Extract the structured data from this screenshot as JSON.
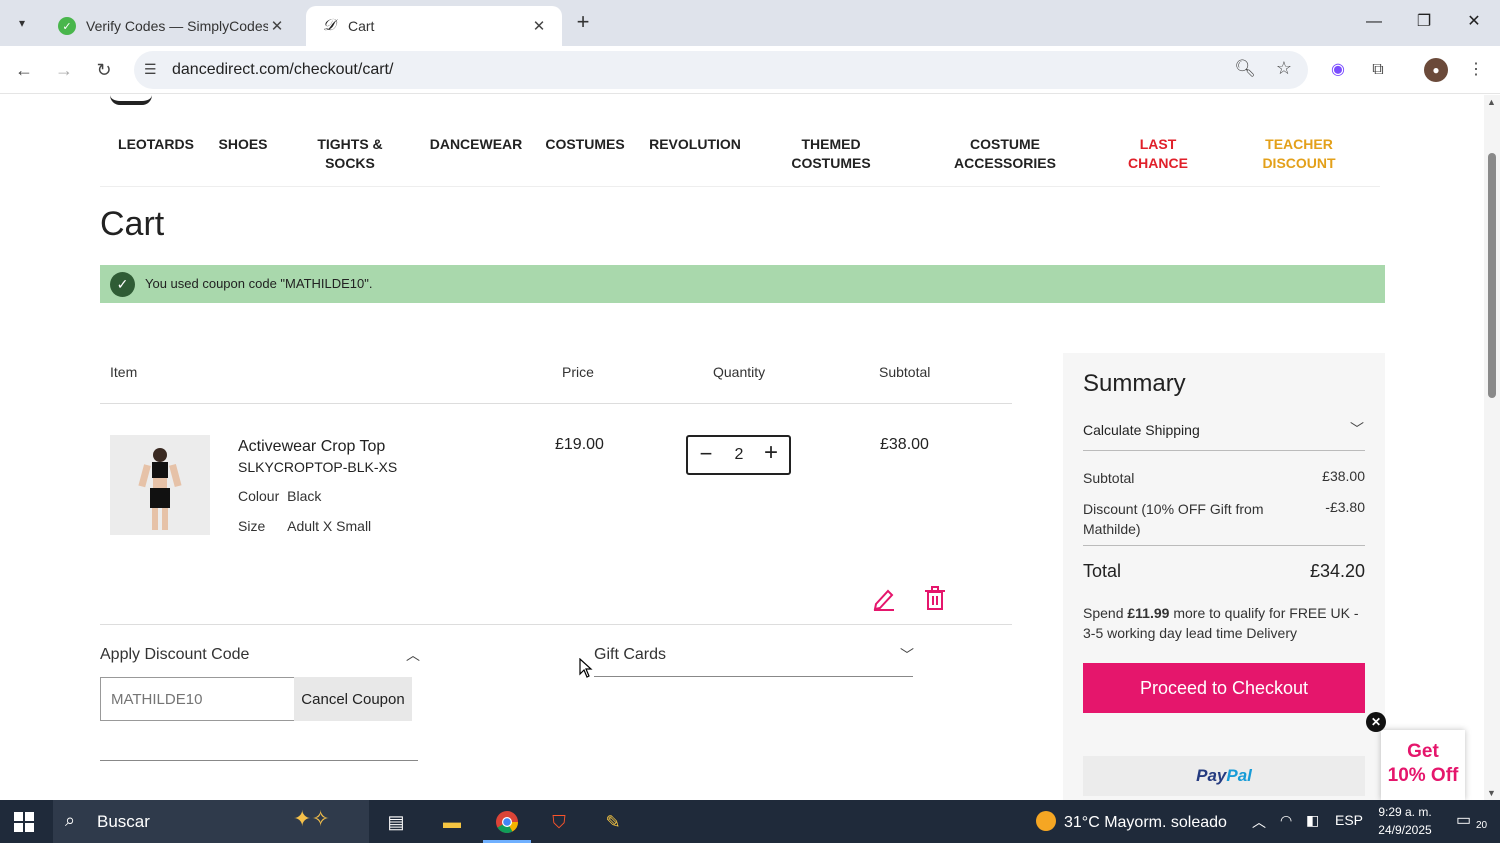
{
  "browser": {
    "tabs": [
      {
        "title": "Verify Codes — SimplyCodes",
        "active": false
      },
      {
        "title": "Cart",
        "active": true
      }
    ],
    "url": "dancedirect.com/checkout/cart/"
  },
  "nav": {
    "items": [
      {
        "label": "LEOTARDS",
        "color": "#222222"
      },
      {
        "label": "SHOES",
        "color": "#222222"
      },
      {
        "label": "TIGHTS &\nSOCKS",
        "color": "#222222"
      },
      {
        "label": "DANCEWEAR",
        "color": "#222222"
      },
      {
        "label": "COSTUMES",
        "color": "#222222"
      },
      {
        "label": "REVOLUTION",
        "color": "#222222"
      },
      {
        "label": "THEMED\nCOSTUMES",
        "color": "#222222"
      },
      {
        "label": "COSTUME\nACCESSORIES",
        "color": "#222222"
      },
      {
        "label": "LAST\nCHANCE",
        "color": "#e0202a"
      },
      {
        "label": "TEACHER\nDISCOUNT",
        "color": "#e3a01a"
      }
    ]
  },
  "cart": {
    "title": "Cart",
    "alert": "You used coupon code \"MATHILDE10\".",
    "headers": {
      "item": "Item",
      "price": "Price",
      "quantity": "Quantity",
      "subtotal": "Subtotal"
    },
    "item": {
      "name": "Activewear Crop Top",
      "sku": "SLKYCROPTOP-BLK-XS",
      "colour_label": "Colour",
      "colour_value": "Black",
      "size_label": "Size",
      "size_value": "Adult X Small",
      "price": "£19.00",
      "quantity": "2",
      "subtotal": "£38.00"
    },
    "discount": {
      "title": "Apply Discount Code",
      "placeholder": "MATHILDE10",
      "cancel_label": "Cancel Coupon"
    },
    "gift_cards": {
      "title": "Gift Cards"
    }
  },
  "summary": {
    "title": "Summary",
    "shipping": "Calculate Shipping",
    "subtotal_label": "Subtotal",
    "subtotal_value": "£38.00",
    "discount_label": "Discount (10% OFF Gift from Mathilde)",
    "discount_value": "-£3.80",
    "total_label": "Total",
    "total_value": "£34.20",
    "spend_pre": "Spend ",
    "spend_amount": "£11.99",
    "spend_post": " more to qualify for FREE UK - 3-5 working day lead time Delivery",
    "checkout_label": "Proceed to Checkout",
    "paypal_1": "Pay",
    "paypal_2": "Pal"
  },
  "promo": {
    "line1": "Get",
    "line2": "10% Off"
  },
  "taskbar": {
    "search": "Buscar",
    "weather": "31°C  Mayorm. soleado",
    "lang": "ESP",
    "time": "9:29 a. m.",
    "date": "24/9/2025",
    "notifications": "20"
  },
  "colors": {
    "accent": "#e5166c",
    "alert_bg": "#a9d8ac",
    "alert_check": "#2f5c35"
  }
}
